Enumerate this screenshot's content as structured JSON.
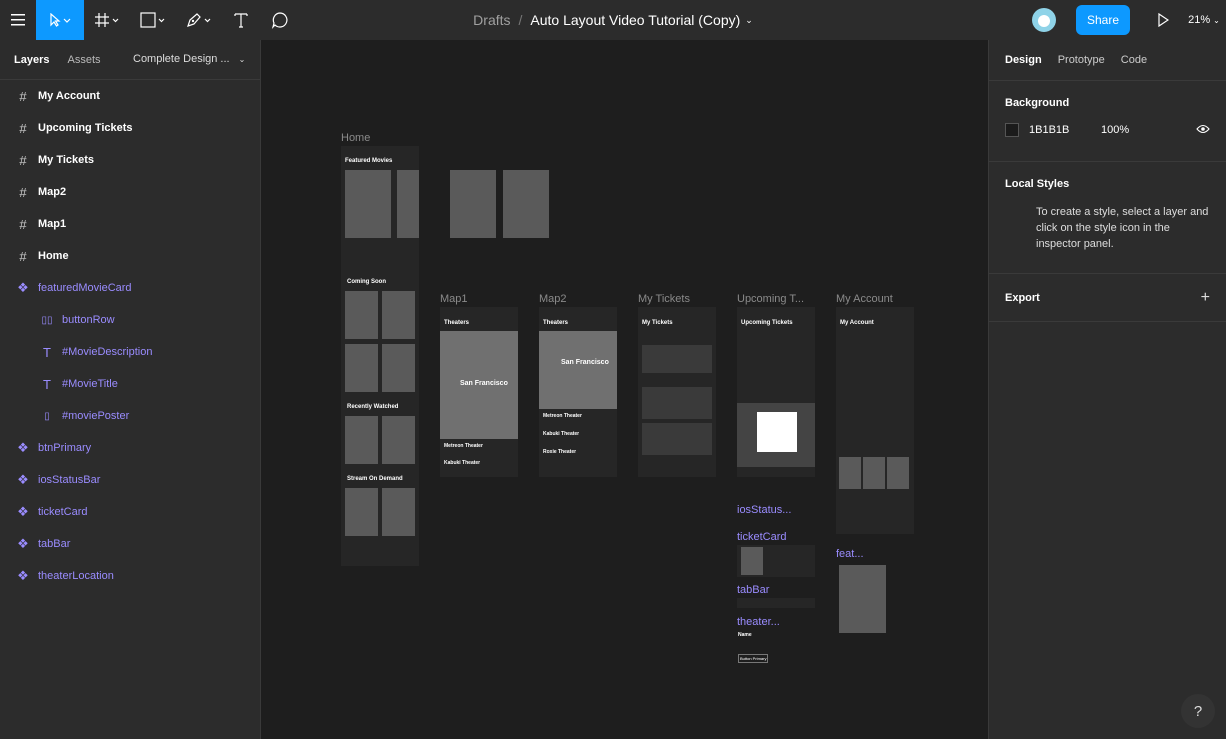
{
  "toolbar": {
    "breadcrumb_drafts": "Drafts",
    "separator": "/",
    "file_name": "Auto Layout Video Tutorial (Copy)",
    "share_label": "Share",
    "zoom": "21%"
  },
  "left_panel": {
    "tabs": [
      "Layers",
      "Assets"
    ],
    "page_name": "Complete Design ...",
    "layers": [
      {
        "name": "My Account",
        "type": "frame"
      },
      {
        "name": "Upcoming Tickets",
        "type": "frame"
      },
      {
        "name": "My Tickets",
        "type": "frame"
      },
      {
        "name": "Map2",
        "type": "frame"
      },
      {
        "name": "Map1",
        "type": "frame"
      },
      {
        "name": "Home",
        "type": "frame"
      },
      {
        "name": "featuredMovieCard",
        "type": "component"
      },
      {
        "name": "buttonRow",
        "type": "child"
      },
      {
        "name": "#MovieDescription",
        "type": "child"
      },
      {
        "name": "#MovieTitle",
        "type": "child"
      },
      {
        "name": "#moviePoster",
        "type": "child"
      },
      {
        "name": "btnPrimary",
        "type": "component"
      },
      {
        "name": "iosStatusBar",
        "type": "component"
      },
      {
        "name": "ticketCard",
        "type": "component"
      },
      {
        "name": "tabBar",
        "type": "component"
      },
      {
        "name": "theaterLocation",
        "type": "component"
      }
    ]
  },
  "canvas": {
    "frames": {
      "home": "Home",
      "map1": "Map1",
      "map2": "Map2",
      "my_tickets": "My Tickets",
      "upcoming": "Upcoming T...",
      "my_account": "My Account"
    },
    "components": {
      "status_bar": "iosStatus...",
      "ticket_card": "ticketCard",
      "tab_bar": "tabBar",
      "theater": "theater...",
      "featured": "feat..."
    },
    "screen_text": {
      "featured_movies": "Featured Movies",
      "coming_soon": "Coming Soon",
      "recently_watched": "Recently Watched",
      "stream_on_demand": "Stream On Demand",
      "theaters": "Theaters",
      "my_tickets": "My Tickets",
      "upcoming_tickets": "Upcoming Tickets",
      "my_account": "My Account",
      "metreon": "Metreon Theater",
      "kabuki": "Kabuki Theater",
      "roxie": "Roxie Theater",
      "map_city": "San Francisco",
      "name_label": "Name",
      "btn_primary": "Button Primary"
    }
  },
  "right_panel": {
    "tabs": [
      "Design",
      "Prototype",
      "Code"
    ],
    "background_label": "Background",
    "bg_color": "1B1B1B",
    "bg_opacity": "100%",
    "local_styles_label": "Local Styles",
    "local_styles_hint": "To create a style, select a layer and click on the style icon in the inspector panel.",
    "export_label": "Export"
  },
  "help_label": "?"
}
